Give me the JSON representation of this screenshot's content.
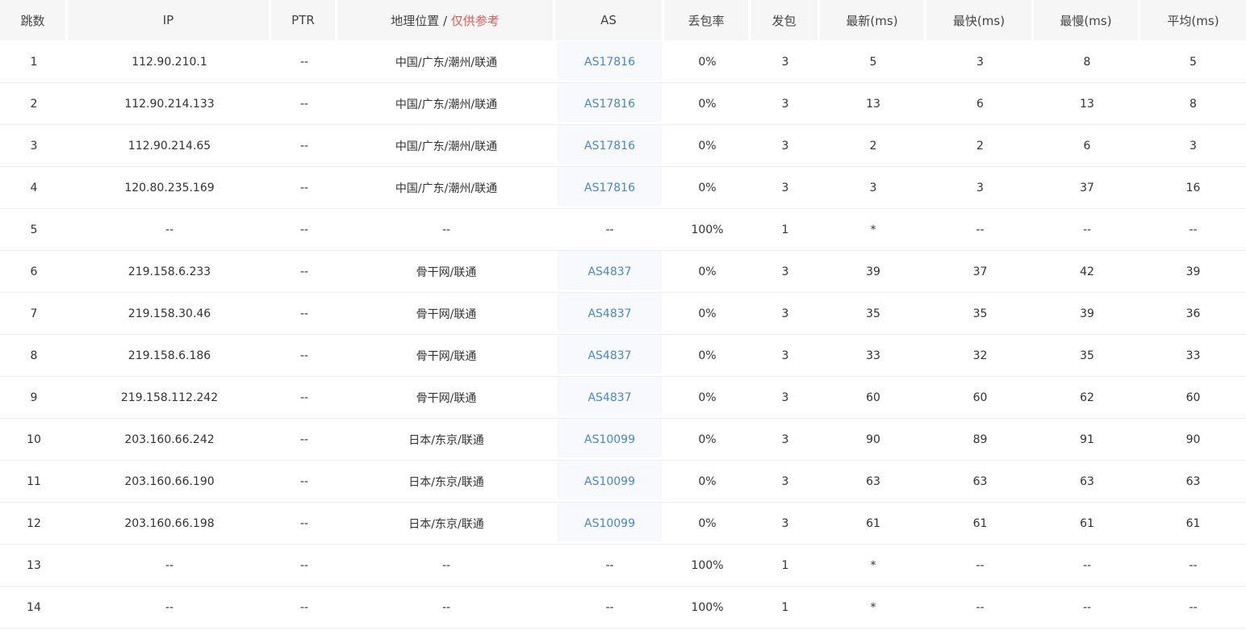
{
  "table": {
    "headers": {
      "hop": "跳数",
      "ip": "IP",
      "ptr": "PTR",
      "geo": "地理位置",
      "geo_sep": " / ",
      "geo_note": "仅供参考",
      "as": "AS",
      "loss": "丢包率",
      "sent": "发包",
      "last": "最新(ms)",
      "best": "最快(ms)",
      "worst": "最慢(ms)",
      "avg": "平均(ms)"
    },
    "rows": [
      {
        "hop": "1",
        "ip": "112.90.210.1",
        "ptr": "--",
        "geo": "中国/广东/潮州/联通",
        "as": "AS17816",
        "loss": "0%",
        "sent": "3",
        "last": "5",
        "best": "3",
        "worst": "8",
        "avg": "5"
      },
      {
        "hop": "2",
        "ip": "112.90.214.133",
        "ptr": "--",
        "geo": "中国/广东/潮州/联通",
        "as": "AS17816",
        "loss": "0%",
        "sent": "3",
        "last": "13",
        "best": "6",
        "worst": "13",
        "avg": "8"
      },
      {
        "hop": "3",
        "ip": "112.90.214.65",
        "ptr": "--",
        "geo": "中国/广东/潮州/联通",
        "as": "AS17816",
        "loss": "0%",
        "sent": "3",
        "last": "2",
        "best": "2",
        "worst": "6",
        "avg": "3"
      },
      {
        "hop": "4",
        "ip": "120.80.235.169",
        "ptr": "--",
        "geo": "中国/广东/潮州/联通",
        "as": "AS17816",
        "loss": "0%",
        "sent": "3",
        "last": "3",
        "best": "3",
        "worst": "37",
        "avg": "16"
      },
      {
        "hop": "5",
        "ip": "--",
        "ptr": "--",
        "geo": "--",
        "as": "--",
        "loss": "100%",
        "sent": "1",
        "last": "*",
        "best": "--",
        "worst": "--",
        "avg": "--"
      },
      {
        "hop": "6",
        "ip": "219.158.6.233",
        "ptr": "--",
        "geo": "骨干网/联通",
        "as": "AS4837",
        "loss": "0%",
        "sent": "3",
        "last": "39",
        "best": "37",
        "worst": "42",
        "avg": "39"
      },
      {
        "hop": "7",
        "ip": "219.158.30.46",
        "ptr": "--",
        "geo": "骨干网/联通",
        "as": "AS4837",
        "loss": "0%",
        "sent": "3",
        "last": "35",
        "best": "35",
        "worst": "39",
        "avg": "36"
      },
      {
        "hop": "8",
        "ip": "219.158.6.186",
        "ptr": "--",
        "geo": "骨干网/联通",
        "as": "AS4837",
        "loss": "0%",
        "sent": "3",
        "last": "33",
        "best": "32",
        "worst": "35",
        "avg": "33"
      },
      {
        "hop": "9",
        "ip": "219.158.112.242",
        "ptr": "--",
        "geo": "骨干网/联通",
        "as": "AS4837",
        "loss": "0%",
        "sent": "3",
        "last": "60",
        "best": "60",
        "worst": "62",
        "avg": "60"
      },
      {
        "hop": "10",
        "ip": "203.160.66.242",
        "ptr": "--",
        "geo": "日本/东京/联通",
        "as": "AS10099",
        "loss": "0%",
        "sent": "3",
        "last": "90",
        "best": "89",
        "worst": "91",
        "avg": "90"
      },
      {
        "hop": "11",
        "ip": "203.160.66.190",
        "ptr": "--",
        "geo": "日本/东京/联通",
        "as": "AS10099",
        "loss": "0%",
        "sent": "3",
        "last": "63",
        "best": "63",
        "worst": "63",
        "avg": "63"
      },
      {
        "hop": "12",
        "ip": "203.160.66.198",
        "ptr": "--",
        "geo": "日本/东京/联通",
        "as": "AS10099",
        "loss": "0%",
        "sent": "3",
        "last": "61",
        "best": "61",
        "worst": "61",
        "avg": "61"
      },
      {
        "hop": "13",
        "ip": "--",
        "ptr": "--",
        "geo": "--",
        "as": "--",
        "loss": "100%",
        "sent": "1",
        "last": "*",
        "best": "--",
        "worst": "--",
        "avg": "--"
      },
      {
        "hop": "14",
        "ip": "--",
        "ptr": "--",
        "geo": "--",
        "as": "--",
        "loss": "100%",
        "sent": "1",
        "last": "*",
        "best": "--",
        "worst": "--",
        "avg": "--"
      }
    ]
  }
}
